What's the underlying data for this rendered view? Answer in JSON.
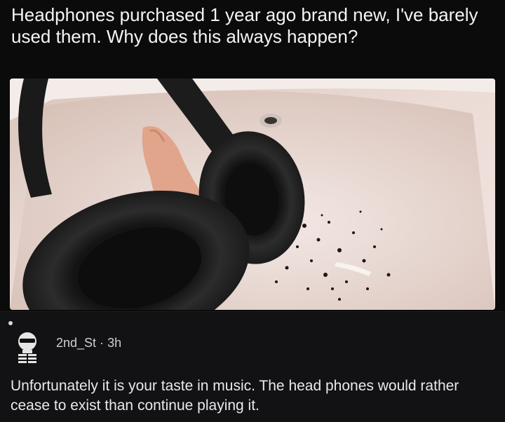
{
  "post": {
    "title": "Headphones purchased 1 year ago brand new, I've barely used them. Why does this always happen?"
  },
  "photo": {
    "icon": "photo-headphones-in-sink"
  },
  "comment": {
    "username": "2nd_St",
    "separator": "·",
    "time": "3h",
    "text": "Unfortunately it is your taste in music. The head phones would rather cease to exist than continue playing it.",
    "avatar_icon": "skeleton-avatar-icon"
  },
  "colors": {
    "background": "#0b0b0c",
    "comment_bg": "#121214",
    "text": "#f2f2f2",
    "meta": "#cfcfd3"
  }
}
